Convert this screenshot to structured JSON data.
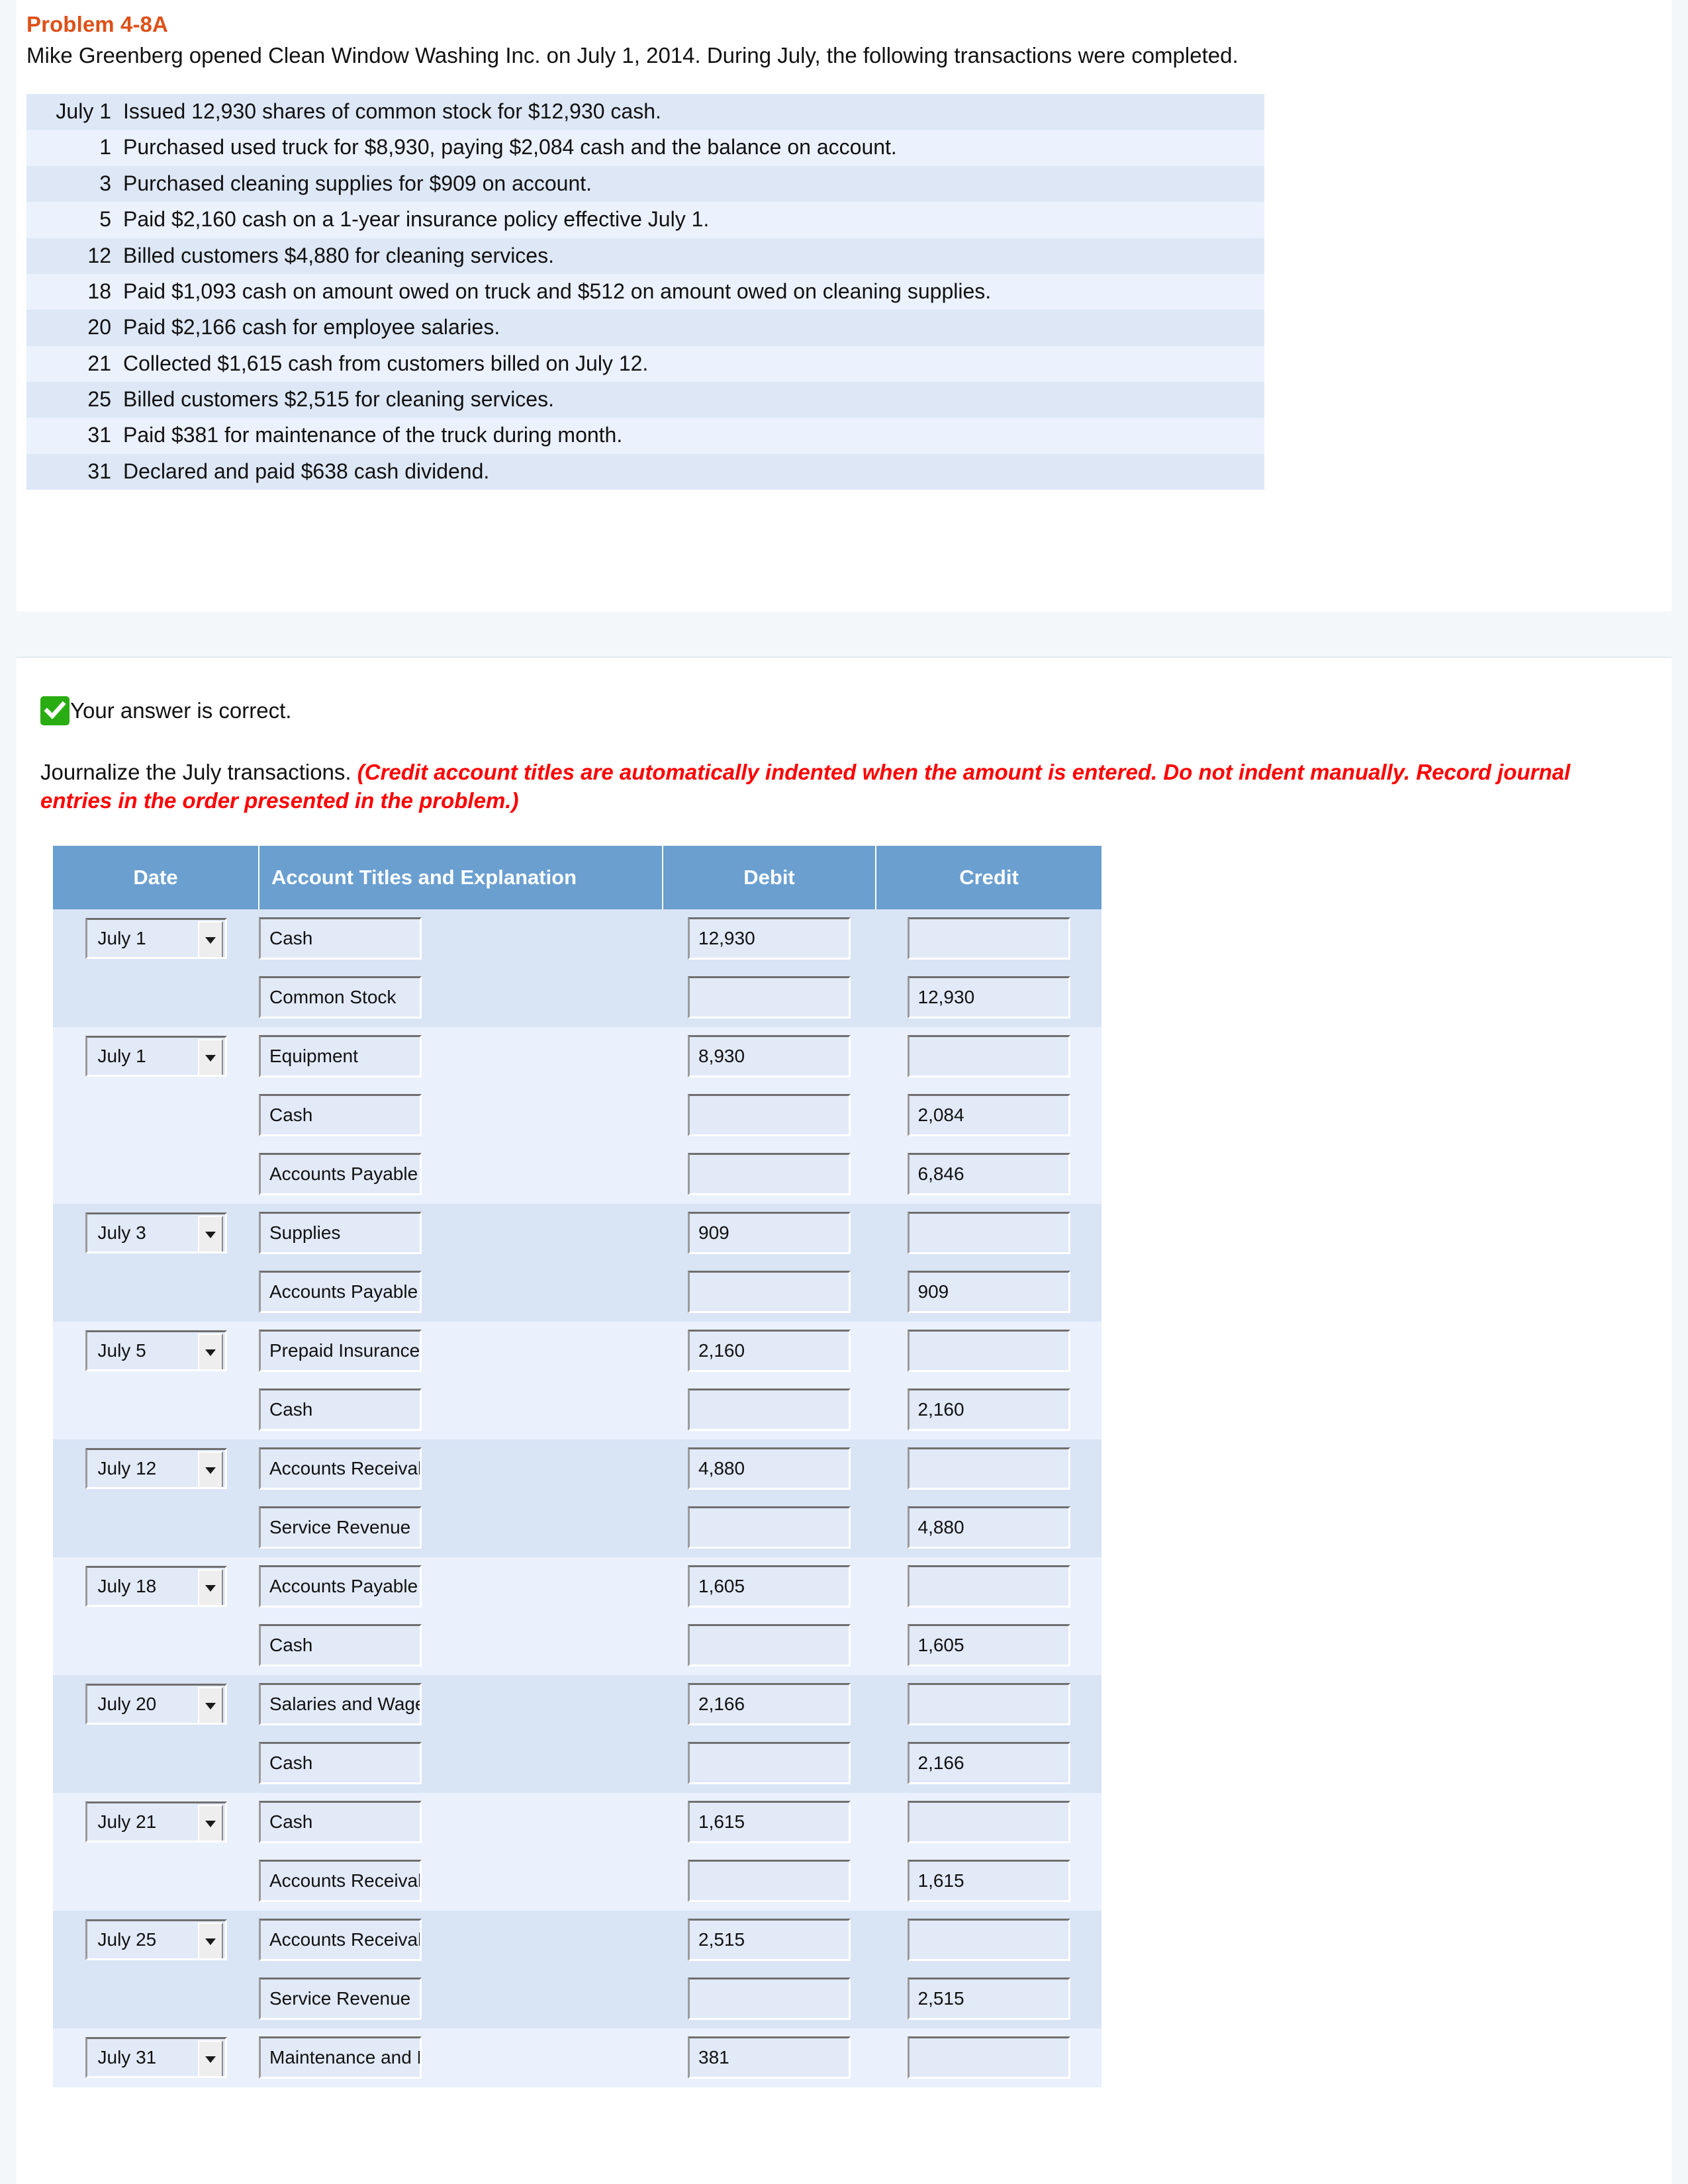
{
  "problem": {
    "title": "Problem 4-8A",
    "intro": "Mike Greenberg opened Clean Window Washing Inc. on July 1, 2014. During July, the following transactions were completed.",
    "transactions": [
      {
        "date": "July 1",
        "desc": "Issued 12,930 shares of common stock for $12,930 cash."
      },
      {
        "date": "1",
        "desc": "Purchased used truck for $8,930, paying $2,084 cash and the balance on account."
      },
      {
        "date": "3",
        "desc": "Purchased cleaning supplies for $909 on account."
      },
      {
        "date": "5",
        "desc": "Paid $2,160 cash on a 1-year insurance policy effective July 1."
      },
      {
        "date": "12",
        "desc": "Billed customers $4,880 for cleaning services."
      },
      {
        "date": "18",
        "desc": "Paid $1,093 cash on amount owed on truck and $512 on amount owed on cleaning supplies."
      },
      {
        "date": "20",
        "desc": "Paid $2,166 cash for employee salaries."
      },
      {
        "date": "21",
        "desc": "Collected $1,615 cash from customers billed on July 12."
      },
      {
        "date": "25",
        "desc": "Billed customers $2,515 for cleaning services."
      },
      {
        "date": "31",
        "desc": "Paid $381 for maintenance of the truck during month."
      },
      {
        "date": "31",
        "desc": "Declared and paid $638 cash dividend."
      }
    ]
  },
  "answer": {
    "status_text": "Your answer is correct.",
    "status_icon": "check-icon",
    "status_color": "#2aad12",
    "instruction_text": "Journalize the July transactions. ",
    "instruction_hint": "(Credit account titles are automatically indented when the amount is entered. Do not indent manually. Record journal entries in the order presented in the problem.)",
    "hint_color": "#ff0000"
  },
  "journal": {
    "header_color": "#6a9fd0",
    "columns": {
      "date": "Date",
      "account": "Account Titles and Explanation",
      "debit": "Debit",
      "credit": "Credit"
    },
    "rows": [
      {
        "group": 0,
        "date": "July 1",
        "account": "Cash",
        "debit": "12,930",
        "credit": ""
      },
      {
        "group": 0,
        "date": "",
        "account": "Common Stock",
        "debit": "",
        "credit": "12,930"
      },
      {
        "group": 1,
        "date": "July 1",
        "account": "Equipment",
        "debit": "8,930",
        "credit": ""
      },
      {
        "group": 1,
        "date": "",
        "account": "Cash",
        "debit": "",
        "credit": "2,084"
      },
      {
        "group": 1,
        "date": "",
        "account": "Accounts Payable",
        "debit": "",
        "credit": "6,846"
      },
      {
        "group": 2,
        "date": "July 3",
        "account": "Supplies",
        "debit": "909",
        "credit": ""
      },
      {
        "group": 2,
        "date": "",
        "account": "Accounts Payable",
        "debit": "",
        "credit": "909"
      },
      {
        "group": 3,
        "date": "July 5",
        "account": "Prepaid Insurance",
        "debit": "2,160",
        "credit": ""
      },
      {
        "group": 3,
        "date": "",
        "account": "Cash",
        "debit": "",
        "credit": "2,160"
      },
      {
        "group": 4,
        "date": "July 12",
        "account": "Accounts Receivable",
        "debit": "4,880",
        "credit": ""
      },
      {
        "group": 4,
        "date": "",
        "account": "Service Revenue",
        "debit": "",
        "credit": "4,880"
      },
      {
        "group": 5,
        "date": "July 18",
        "account": "Accounts Payable",
        "debit": "1,605",
        "credit": ""
      },
      {
        "group": 5,
        "date": "",
        "account": "Cash",
        "debit": "",
        "credit": "1,605"
      },
      {
        "group": 6,
        "date": "July 20",
        "account": "Salaries and Wages Expense",
        "debit": "2,166",
        "credit": ""
      },
      {
        "group": 6,
        "date": "",
        "account": "Cash",
        "debit": "",
        "credit": "2,166"
      },
      {
        "group": 7,
        "date": "July 21",
        "account": "Cash",
        "debit": "1,615",
        "credit": ""
      },
      {
        "group": 7,
        "date": "",
        "account": "Accounts Receivable",
        "debit": "",
        "credit": "1,615"
      },
      {
        "group": 8,
        "date": "July 25",
        "account": "Accounts Receivable",
        "debit": "2,515",
        "credit": ""
      },
      {
        "group": 8,
        "date": "",
        "account": "Service Revenue",
        "debit": "",
        "credit": "2,515"
      },
      {
        "group": 9,
        "date": "July 31",
        "account": "Maintenance and Repairs Expense",
        "debit": "381",
        "credit": ""
      }
    ]
  }
}
